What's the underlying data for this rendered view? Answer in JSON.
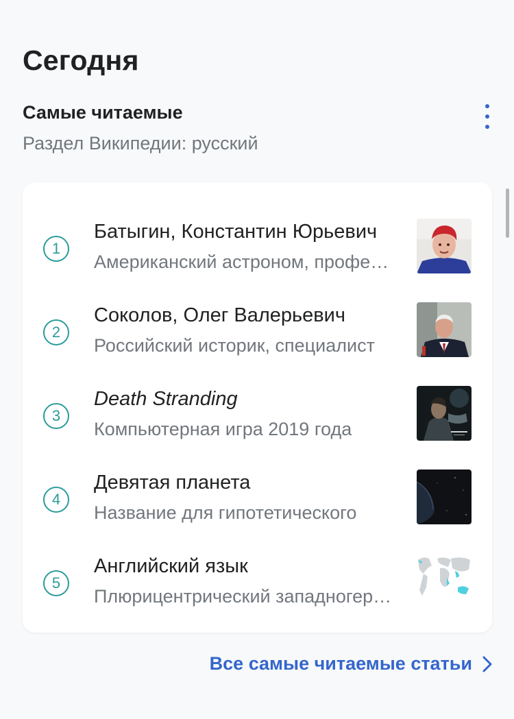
{
  "header": {
    "title": "Сегодня"
  },
  "section": {
    "title": "Самые читаемые",
    "subtitle": "Раздел Википедии: русский"
  },
  "articles": [
    {
      "rank": "1",
      "title": "Батыгин, Константин Юрьевич",
      "description": "Американский астроном, профессор",
      "thumbnail": "portrait-man-red-hair"
    },
    {
      "rank": "2",
      "title": "Соколов, Олег Валерьевич",
      "description": "Российский историк, специалист",
      "thumbnail": "portrait-man-suit"
    },
    {
      "rank": "3",
      "title": "Death Stranding",
      "description": "Компьютерная игра 2019 года",
      "thumbnail": "game-cover"
    },
    {
      "rank": "4",
      "title": "Девятая планета",
      "description": "Название для гипотетического",
      "thumbnail": "dark-planet"
    },
    {
      "rank": "5",
      "title": "Английский язык",
      "description": "Плюрицентрический западногерманский",
      "thumbnail": "world-map"
    }
  ],
  "footer": {
    "more_link": "Все самые читаемые статьи"
  },
  "colors": {
    "accent": "#3366cc",
    "rank": "#2a9c9a",
    "secondary_text": "#72777d",
    "background": "#f8f9fa"
  }
}
